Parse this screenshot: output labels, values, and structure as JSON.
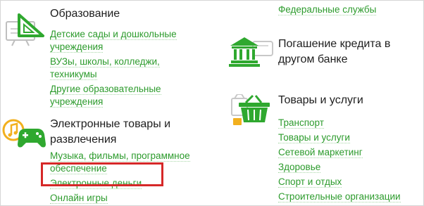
{
  "colors": {
    "link": "#2c9b2c",
    "title": "#1e1e1e",
    "icon_green": "#2fa82f",
    "icon_yellow": "#f2b01e",
    "highlight": "#d62828"
  },
  "left_column": {
    "education": {
      "icon": "education-icon",
      "title": "Образование",
      "links": [
        "Детские сады и дошкольные учреждения",
        "ВУЗы, школы, колледжи, техникумы",
        "Другие образовательные учреждения"
      ]
    },
    "entertainment": {
      "icon": "gamepad-music-icon",
      "title": "Электронные товары и развлечения",
      "links": [
        "Музыка, фильмы, программное обеспечение",
        "Электронные деньги",
        "Онлайн игры"
      ]
    }
  },
  "right_column": {
    "federal": {
      "links": [
        "Федеральные службы"
      ]
    },
    "credit": {
      "icon": "bank-icon",
      "title": "Погашение кредита в другом банке"
    },
    "goods": {
      "icon": "shopping-basket-icon",
      "title": "Товары и услуги",
      "links": [
        "Транспорт",
        "Товары и услуги",
        "Сетевой маркетинг",
        "Здоровье",
        "Спорт и отдых",
        "Строительные организации"
      ]
    }
  }
}
